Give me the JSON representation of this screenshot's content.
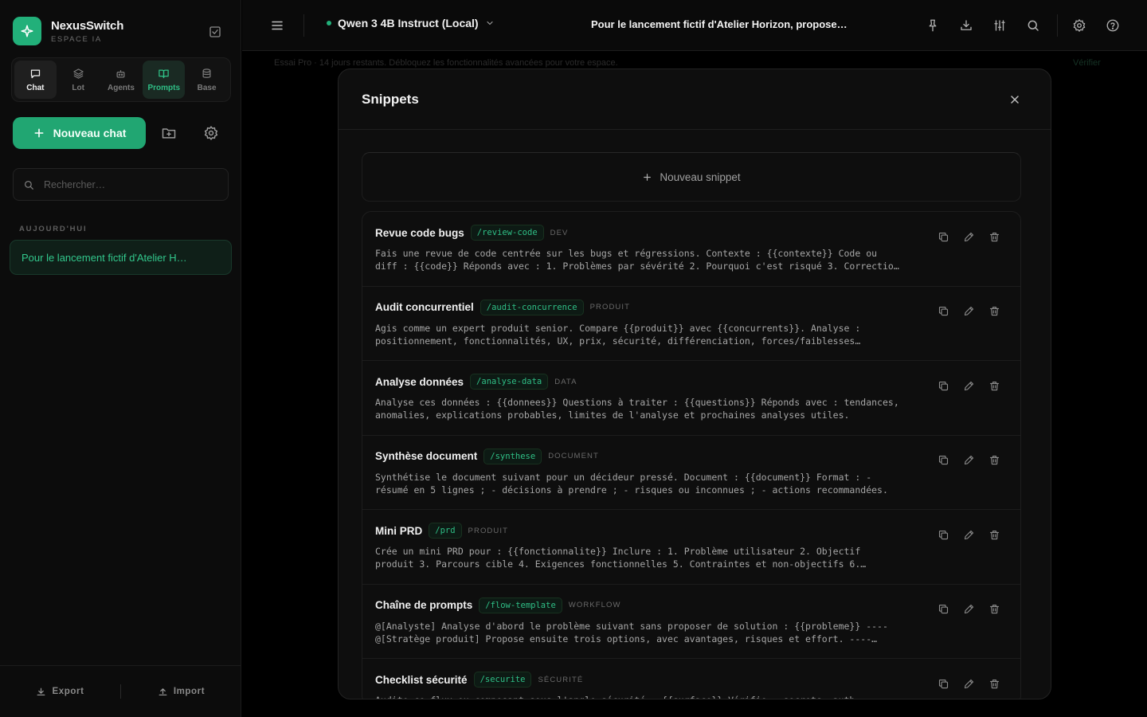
{
  "brand": {
    "name": "NexusSwitch",
    "subtitle": "ESPACE IA"
  },
  "nav_tabs": [
    {
      "label": "Chat",
      "icon": "chat-bubble-icon"
    },
    {
      "label": "Lot",
      "icon": "layers-icon"
    },
    {
      "label": "Agents",
      "icon": "bot-icon"
    },
    {
      "label": "Prompts",
      "icon": "book-open-icon"
    },
    {
      "label": "Base",
      "icon": "database-icon"
    }
  ],
  "new_chat_label": "Nouveau chat",
  "search_placeholder": "Rechercher…",
  "section_today": "AUJOURD'HUI",
  "conversation_title": "Pour le lancement fictif d'Atelier H…",
  "footer": {
    "export": "Export",
    "import": "Import"
  },
  "topbar": {
    "model": "Qwen 3 4B Instruct (Local)",
    "chat_title": "Pour le lancement fictif d'Atelier Horizon, propose…"
  },
  "behind": {
    "banner": "Essai Pro · 14 jours restants. Débloquez les fonctionnalités avancées pour votre espace.",
    "right": "Vérifier"
  },
  "modal": {
    "title": "Snippets",
    "new_snippet": "Nouveau snippet",
    "snippets": [
      {
        "title": "Revue code bugs",
        "command": "/review-code",
        "category": "DEV",
        "body": "Fais une revue de code centrée sur les bugs et régressions. Contexte : {{contexte}} Code ou\ndiff : {{code}} Réponds avec : 1. Problèmes par sévérité 2. Pourquoi c'est risqué 3. Correctio…"
      },
      {
        "title": "Audit concurrentiel",
        "command": "/audit-concurrence",
        "category": "PRODUIT",
        "body": "Agis comme un expert produit senior. Compare {{produit}} avec {{concurrents}}. Analyse :\npositionnement, fonctionnalités, UX, prix, sécurité, différenciation, forces/faiblesses…"
      },
      {
        "title": "Analyse données",
        "command": "/analyse-data",
        "category": "DATA",
        "body": "Analyse ces données : {{donnees}} Questions à traiter : {{questions}} Réponds avec : tendances,\nanomalies, explications probables, limites de l'analyse et prochaines analyses utiles."
      },
      {
        "title": "Synthèse document",
        "command": "/synthese",
        "category": "DOCUMENT",
        "body": "Synthétise le document suivant pour un décideur pressé. Document : {{document}} Format : -\nrésumé en 5 lignes ; - décisions à prendre ; - risques ou inconnues ; - actions recommandées."
      },
      {
        "title": "Mini PRD",
        "command": "/prd",
        "category": "PRODUIT",
        "body": "Crée un mini PRD pour : {{fonctionnalite}} Inclure : 1. Problème utilisateur 2. Objectif\nproduit 3. Parcours cible 4. Exigences fonctionnelles 5. Contraintes et non-objectifs 6.…"
      },
      {
        "title": "Chaîne de prompts",
        "command": "/flow-template",
        "category": "WORKFLOW",
        "body": "@[Analyste] Analyse d'abord le problème suivant sans proposer de solution : {{probleme}} ----\n@[Stratège produit] Propose ensuite trois options, avec avantages, risques et effort. ----…"
      },
      {
        "title": "Checklist sécurité",
        "command": "/securite",
        "category": "SÉCURITÉ",
        "body": "Audite ce flux ou composant sous l'angle sécurité : {{surface}} Vérifie : secrets, auth,\npermissions, validation des entrées, journalisation et exposition de données sensibles."
      }
    ]
  },
  "colors": {
    "accent": "#21a672",
    "accent_text": "#2fbf86",
    "background": "#000000",
    "panel": "#0e0e0e"
  }
}
